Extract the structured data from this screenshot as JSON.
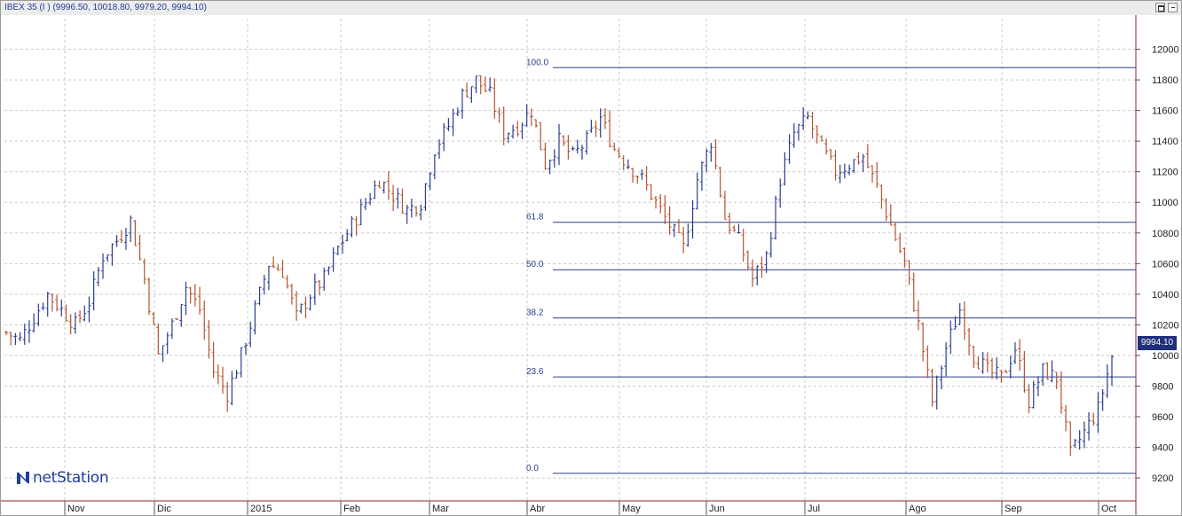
{
  "window": {
    "title": "IBEX 35 (I ) (9996.50, 10018.80, 9979.20, 9994.10)"
  },
  "logo": {
    "text": "netStation",
    "icon": "netstation-n-logo-icon"
  },
  "colors": {
    "up_bar": "#2c3d8f",
    "down_bar": "#b5542f",
    "fib_line": "#2c3d8f",
    "grid": "#c9c9c9",
    "price_tag_bg": "#1f2f7a"
  },
  "last_price": "9994.10",
  "chart_data": {
    "type": "ohlc",
    "instrument": "IBEX 35 (I )",
    "ylim": [
      9050,
      12200
    ],
    "y_ticks": [
      9200,
      9400,
      9600,
      9800,
      10000,
      10200,
      10400,
      10600,
      10800,
      11000,
      11200,
      11400,
      11600,
      11800,
      12000
    ],
    "x_tick_labels": [
      "Nov",
      "Dic",
      "2015",
      "Feb",
      "Mar",
      "Abr",
      "May",
      "Jun",
      "Jul",
      "Ago",
      "Sep",
      "Oct"
    ],
    "grid": true,
    "fibonacci_retracement": [
      {
        "label": "100.0",
        "value": 11880
      },
      {
        "label": "61.8",
        "value": 10870
      },
      {
        "label": "50.0",
        "value": 10560
      },
      {
        "label": "38.2",
        "value": 10245
      },
      {
        "label": "23.6",
        "value": 9860
      },
      {
        "label": "0.0",
        "value": 9230
      }
    ],
    "weekly_close_path": [
      [
        0,
        10150
      ],
      [
        3,
        10100
      ],
      [
        6,
        10250
      ],
      [
        9,
        10400
      ],
      [
        12,
        10300
      ],
      [
        15,
        10200
      ],
      [
        18,
        10350
      ],
      [
        21,
        10650
      ],
      [
        24,
        10750
      ],
      [
        27,
        10880
      ],
      [
        30,
        10500
      ],
      [
        33,
        10000
      ],
      [
        36,
        10200
      ],
      [
        39,
        10450
      ],
      [
        42,
        10300
      ],
      [
        45,
        9900
      ],
      [
        48,
        9750
      ],
      [
        51,
        10000
      ],
      [
        54,
        10300
      ],
      [
        57,
        10600
      ],
      [
        60,
        10550
      ],
      [
        63,
        10250
      ],
      [
        66,
        10400
      ],
      [
        69,
        10500
      ],
      [
        72,
        10700
      ],
      [
        75,
        10850
      ],
      [
        78,
        11000
      ],
      [
        81,
        11150
      ],
      [
        84,
        11050
      ],
      [
        87,
        10950
      ],
      [
        90,
        11000
      ],
      [
        93,
        11350
      ],
      [
        96,
        11500
      ],
      [
        99,
        11700
      ],
      [
        102,
        11800
      ],
      [
        105,
        11700
      ],
      [
        108,
        11450
      ],
      [
        111,
        11500
      ],
      [
        114,
        11600
      ],
      [
        117,
        11250
      ],
      [
        120,
        11400
      ],
      [
        123,
        11300
      ],
      [
        126,
        11400
      ],
      [
        129,
        11550
      ],
      [
        132,
        11350
      ],
      [
        135,
        11250
      ],
      [
        138,
        11150
      ],
      [
        141,
        11000
      ],
      [
        144,
        10850
      ],
      [
        147,
        10700
      ],
      [
        150,
        11150
      ],
      [
        153,
        11400
      ],
      [
        156,
        10900
      ],
      [
        159,
        10750
      ],
      [
        162,
        10500
      ],
      [
        165,
        10650
      ],
      [
        168,
        11150
      ],
      [
        171,
        11450
      ],
      [
        174,
        11550
      ],
      [
        177,
        11350
      ],
      [
        180,
        11200
      ],
      [
        183,
        11250
      ],
      [
        186,
        11300
      ],
      [
        189,
        11100
      ],
      [
        192,
        10850
      ],
      [
        195,
        10600
      ],
      [
        198,
        10200
      ],
      [
        201,
        9700
      ],
      [
        204,
        10050
      ],
      [
        207,
        10300
      ],
      [
        210,
        10000
      ],
      [
        213,
        9900
      ],
      [
        216,
        9850
      ],
      [
        219,
        10050
      ],
      [
        222,
        9700
      ],
      [
        225,
        9900
      ],
      [
        228,
        9850
      ],
      [
        231,
        9350
      ],
      [
        234,
        9500
      ],
      [
        237,
        9650
      ],
      [
        240,
        9994
      ]
    ]
  }
}
